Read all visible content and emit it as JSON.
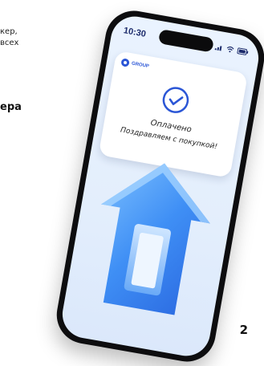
{
  "left_text": {
    "line1": "кер,",
    "line2": "всех",
    "line3": "ера"
  },
  "phone": {
    "status_bar": {
      "time": "10:30",
      "icons": [
        "signal-icon",
        "wifi-icon",
        "battery-icon"
      ]
    },
    "card": {
      "brand": "GROUP",
      "status_title": "Оплачено",
      "status_message": "Поздравляем с покупкой!"
    },
    "illustration": "house-icon"
  },
  "page_number": "2",
  "colors": {
    "accent": "#2b56d6",
    "house_blue": "#3f8ff5",
    "screen_bg": "#eaf3ff"
  }
}
